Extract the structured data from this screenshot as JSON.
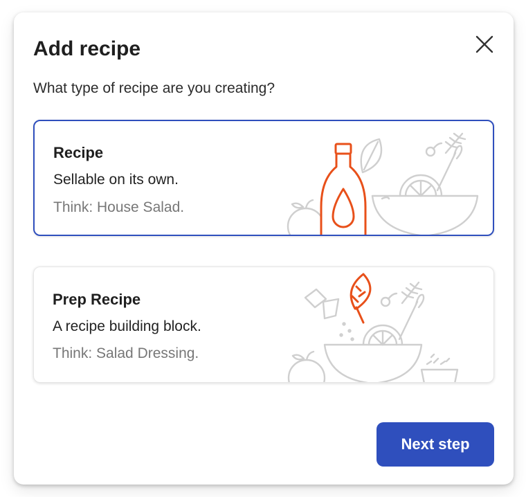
{
  "dialog": {
    "title": "Add recipe",
    "subtitle": "What type of recipe are you creating?"
  },
  "options": [
    {
      "title": "Recipe",
      "description": "Sellable on its own.",
      "hint": "Think: House Salad.",
      "selected": true,
      "illustration": "dressing-bottle-salad-bowl"
    },
    {
      "title": "Prep Recipe",
      "description": "A recipe building block.",
      "hint": "Think: Salad Dressing.",
      "selected": false,
      "illustration": "leaf-salad-bowl"
    }
  ],
  "actions": {
    "next_label": "Next step"
  },
  "icons": {
    "close": "close-icon"
  },
  "colors": {
    "accent": "#2f4fbd",
    "illustration_highlight": "#e8501a",
    "illustration_line": "#cfcfcf",
    "text_primary": "#1f1f1f",
    "text_muted": "#777777"
  }
}
